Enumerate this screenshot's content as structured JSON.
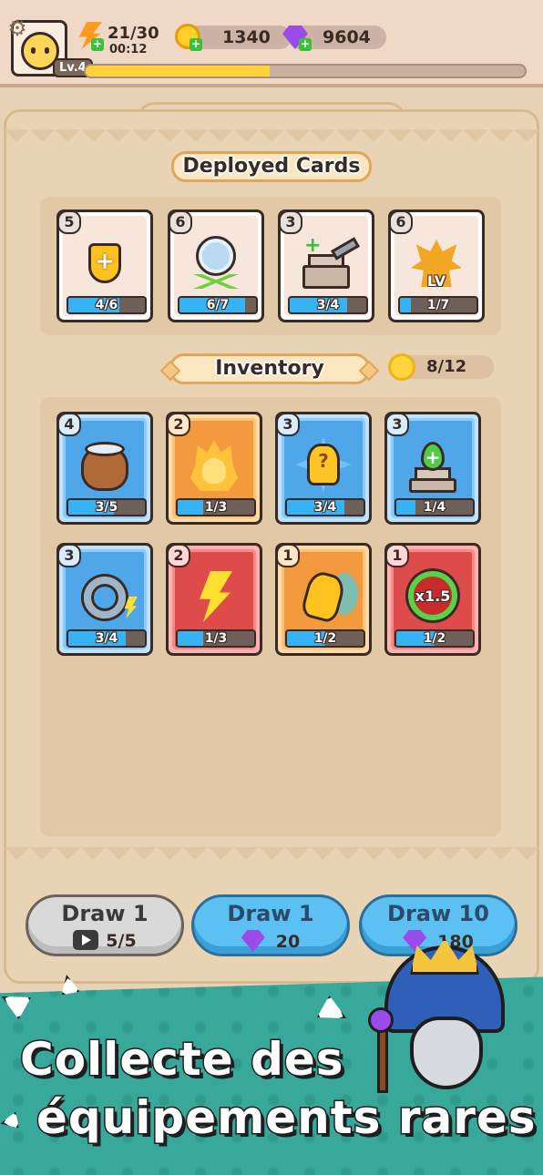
{
  "hud": {
    "energy": "21/30",
    "timer": "00:12",
    "coins": "1340",
    "gems": "9604",
    "level": "Lv.4",
    "xp_fraction": 0.42
  },
  "deployed": {
    "title": "Deployed Cards",
    "cards": [
      {
        "cost": "5",
        "progress": "4/6",
        "fill": 0.67,
        "color": "beige",
        "icon": "shield-plus-icon"
      },
      {
        "cost": "6",
        "progress": "6/7",
        "fill": 0.86,
        "color": "beige",
        "icon": "gear-wings-icon"
      },
      {
        "cost": "3",
        "progress": "3/4",
        "fill": 0.75,
        "color": "beige",
        "icon": "castle-repair-icon"
      },
      {
        "cost": "6",
        "progress": "1/7",
        "fill": 0.14,
        "color": "beige",
        "icon": "level-up-icon",
        "art_text": "LV"
      }
    ]
  },
  "inventory": {
    "title": "Inventory",
    "count": "8/12",
    "cards": [
      {
        "cost": "4",
        "progress": "3/5",
        "fill": 0.6,
        "color": "blue",
        "icon": "money-bag-icon"
      },
      {
        "cost": "2",
        "progress": "1/3",
        "fill": 0.33,
        "color": "orange",
        "icon": "fire-minion-icon"
      },
      {
        "cost": "3",
        "progress": "3/4",
        "fill": 0.75,
        "color": "blue",
        "icon": "mystery-summon-icon"
      },
      {
        "cost": "3",
        "progress": "1/4",
        "fill": 0.25,
        "color": "blue",
        "icon": "castle-heal-icon"
      },
      {
        "cost": "3",
        "progress": "3/4",
        "fill": 0.75,
        "color": "blue",
        "icon": "chain-lightning-icon"
      },
      {
        "cost": "2",
        "progress": "1/3",
        "fill": 0.33,
        "color": "red",
        "icon": "lightning-bolt-icon"
      },
      {
        "cost": "1",
        "progress": "1/2",
        "fill": 0.5,
        "color": "orange",
        "icon": "dash-runner-icon"
      },
      {
        "cost": "1",
        "progress": "1/2",
        "fill": 0.5,
        "color": "red",
        "icon": "speed-cycle-icon",
        "art_text": "x1.5"
      }
    ]
  },
  "draw": {
    "free": {
      "label": "Draw 1",
      "sub": "5/5"
    },
    "one": {
      "label": "Draw 1",
      "sub": "20"
    },
    "ten": {
      "label": "Draw 10",
      "sub": "180"
    }
  },
  "promo": {
    "line1": "Collecte des",
    "line2": "équipements rares"
  },
  "colors": {
    "blue_card": "#4fa6e8",
    "orange_card": "#f39a3f",
    "red_card": "#dd4b4b",
    "progress_fill": "#35b3f5",
    "promo_bg": "#37a89a"
  }
}
